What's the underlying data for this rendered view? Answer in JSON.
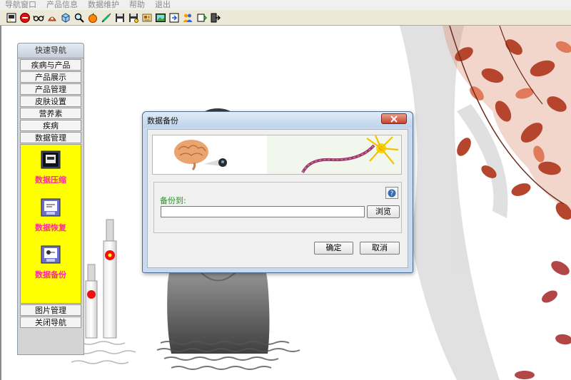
{
  "menubar": {
    "items": [
      "导航窗口",
      "产品信息",
      "数据维护",
      "帮助",
      "退出"
    ]
  },
  "toolbar": {
    "icons": [
      "new-icon",
      "stop-icon",
      "glasses-icon",
      "rocket-icon",
      "box-icon",
      "magnifier-icon",
      "apple-icon",
      "syringe-icon",
      "save-icon",
      "save-as-icon",
      "card-icon",
      "picture-icon",
      "export-icon",
      "users-icon",
      "pin-icon",
      "exit-icon"
    ]
  },
  "nav": {
    "title": "快速导航",
    "buttons": [
      "疾病与产品",
      "产品展示",
      "产品管理",
      "皮肤设置",
      "营养素",
      "疾病",
      "数据管理"
    ],
    "panel_items": [
      {
        "label": "数据压缩",
        "icon": "compress-icon"
      },
      {
        "label": "数据恢复",
        "icon": "restore-icon"
      },
      {
        "label": "数据备份",
        "icon": "backup-icon"
      }
    ],
    "bottom_buttons": [
      "图片管理",
      "关闭导航"
    ],
    "panel_color": "#ffff00",
    "label_color": "#ff2aa0"
  },
  "dialog": {
    "title": "数据备份",
    "backup_to_label": "备份到:",
    "path_value": "",
    "browse_label": "浏览",
    "ok_label": "确定",
    "cancel_label": "取消"
  }
}
